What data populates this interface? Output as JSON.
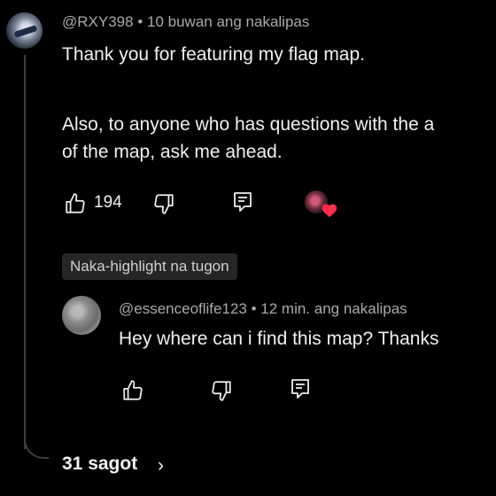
{
  "comment": {
    "author": "@RXY398",
    "separator": "•",
    "time": "10 buwan ang nakalipas",
    "lines": [
      "Thank you for featuring my flag map.",
      "Also, to anyone who has questions with the a",
      "of the map, ask me ahead."
    ],
    "like_count": "194"
  },
  "highlight_badge": "Naka-highlight na tugon",
  "reply": {
    "author": "@essenceoflife123",
    "separator": "•",
    "time": "12 min. ang nakalipas",
    "text": "Hey where can i find this map? Thanks"
  },
  "replies_link": "31 sagot",
  "replies_chevron": "›",
  "colors": {
    "background": "#000000",
    "text": "#f1f1f1",
    "meta": "#aaaaaa",
    "heart": "#ff2d4a"
  }
}
